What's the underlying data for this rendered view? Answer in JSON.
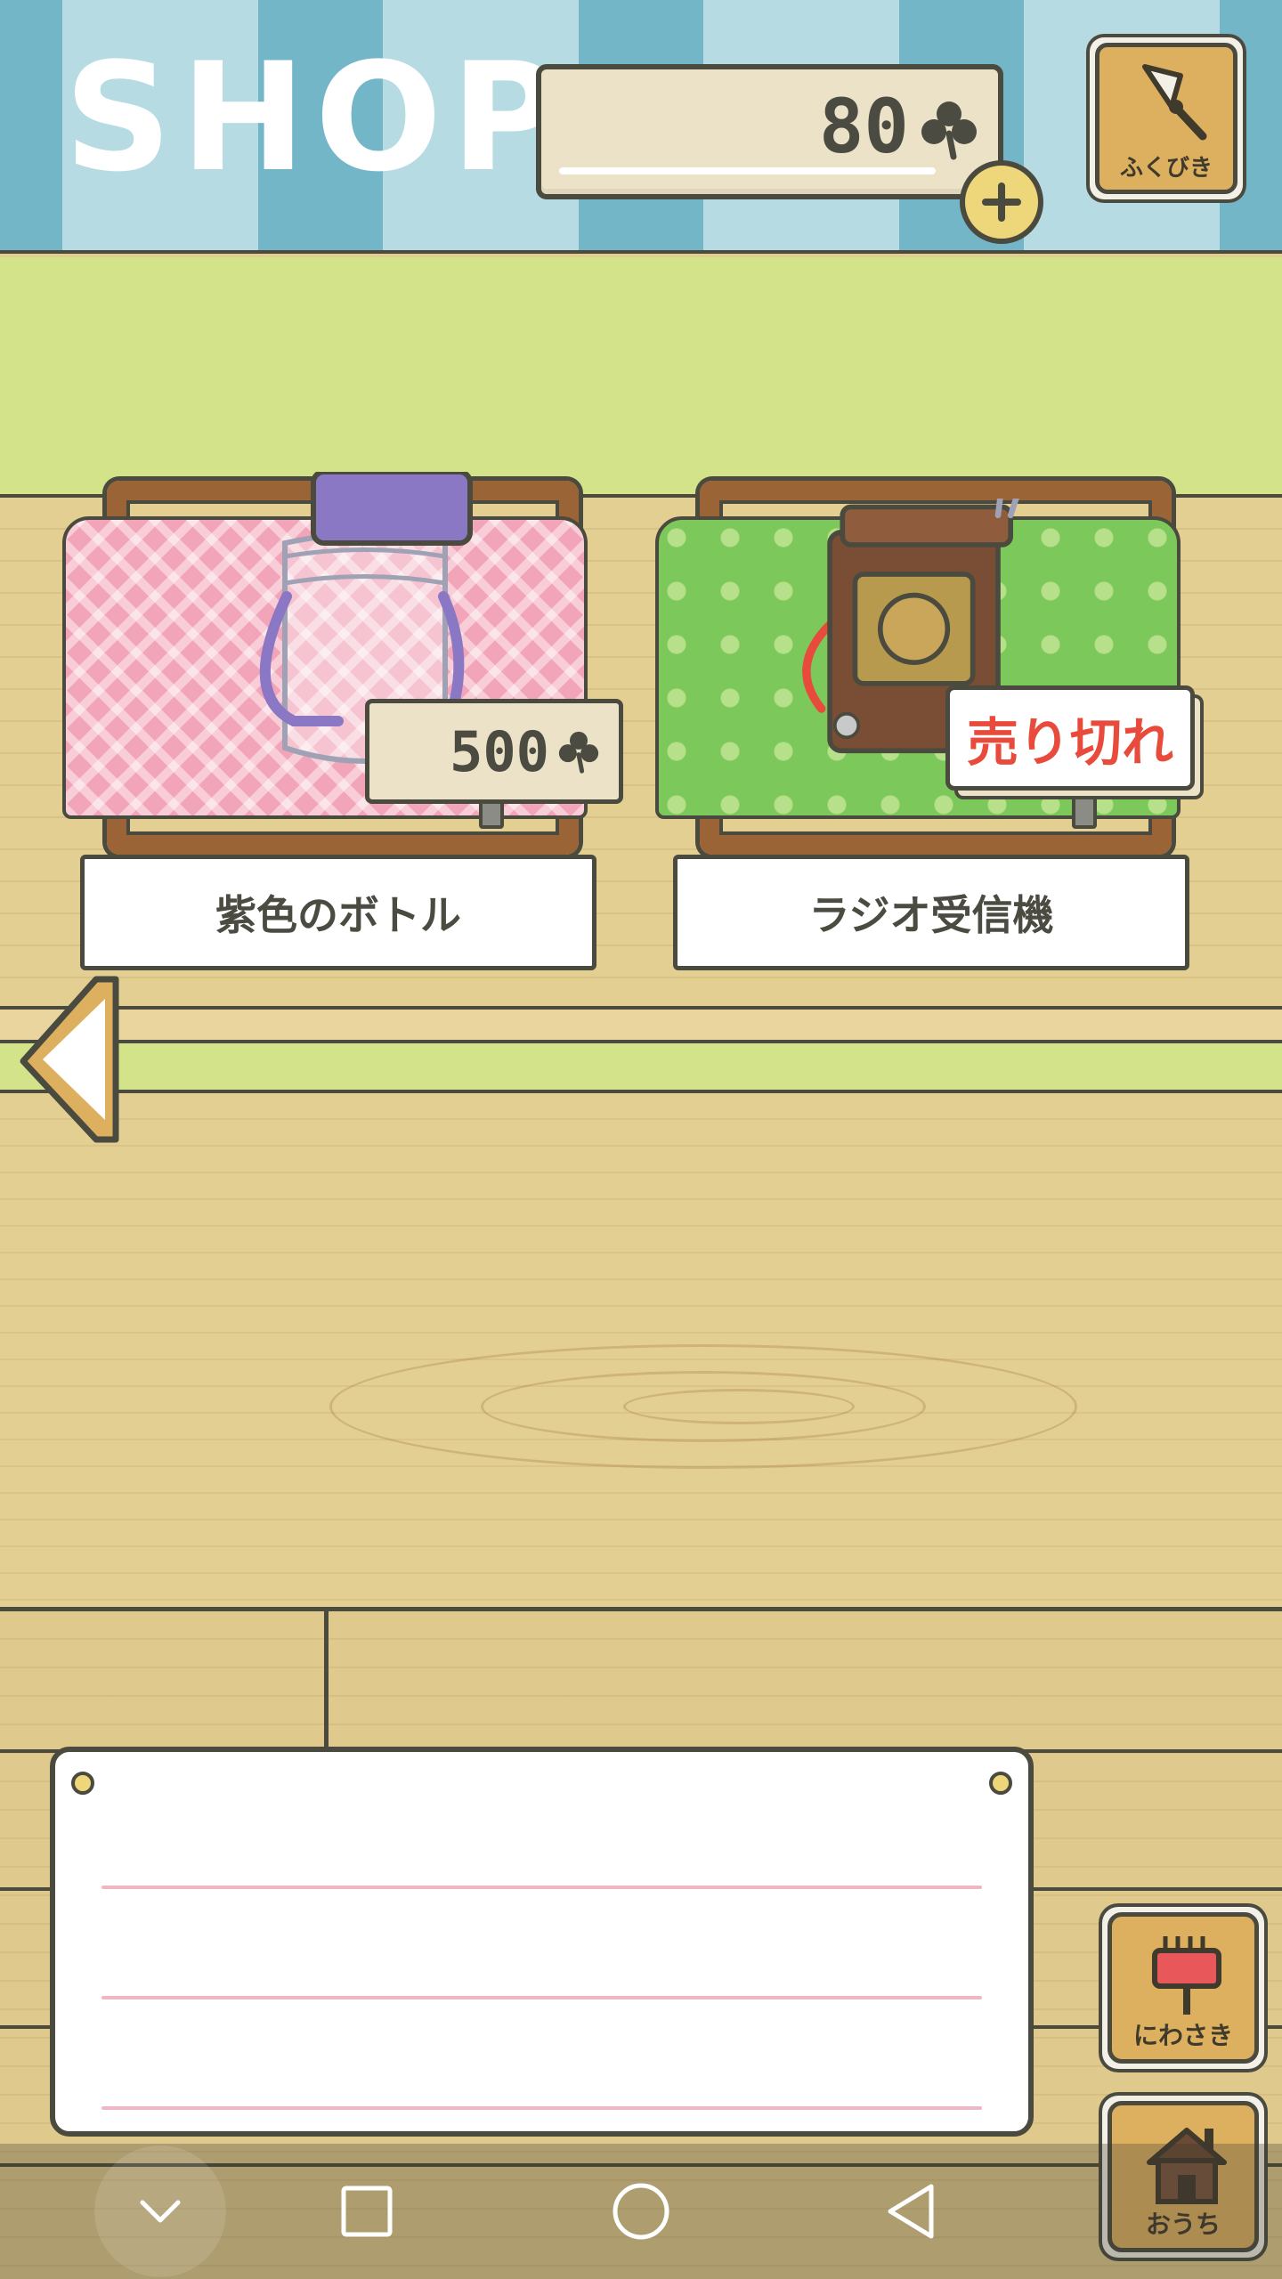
{
  "header": {
    "title": "SHOP",
    "clover_count": "80",
    "lottery_label": "ふくびき"
  },
  "items": [
    {
      "name": "紫色のボトル",
      "price": "500",
      "status": ""
    },
    {
      "name": "ラジオ受信機",
      "price": "",
      "status": "売り切れ"
    }
  ],
  "message_board": {
    "text": ""
  },
  "side_buttons": {
    "garden_label": "にわさき",
    "home_label": "おうち"
  },
  "icons": {
    "currency": "clover-icon",
    "add": "plus-icon",
    "lottery": "bell-icon",
    "previous": "left-arrow-icon",
    "garden": "mailbox-icon",
    "home": "house-icon",
    "nav": [
      "chevron-down-icon",
      "square-icon",
      "circle-icon",
      "triangle-back-icon"
    ]
  },
  "colors": {
    "awning_dark": "#72b6c8",
    "awning_light": "#b6dbe3",
    "wall_green": "#d3e38a",
    "wood": "#e4cf93",
    "sold_out_red": "#e84a3b",
    "button_gold": "#ddb060"
  }
}
